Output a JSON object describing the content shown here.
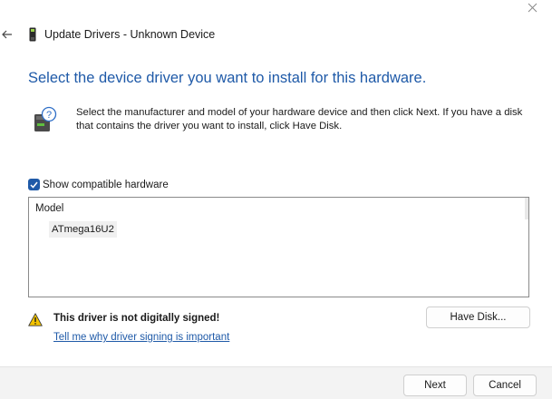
{
  "window": {
    "title": "Update Drivers - Unknown Device",
    "close_icon": "close-icon",
    "back_icon": "arrow-left-icon",
    "device_icon": "usb-device-icon"
  },
  "main": {
    "heading": "Select the device driver you want to install for this hardware.",
    "info_icon": "hardware-help-icon",
    "description": "Select the manufacturer and model of your hardware device and then click Next. If you have a disk that contains the driver you want to install, click Have Disk.",
    "show_compatible": {
      "label": "Show compatible hardware",
      "checked": true
    },
    "model_list": {
      "header": "Model",
      "items": [
        "ATmega16U2"
      ],
      "selected_index": 0
    },
    "warning": {
      "icon": "warning-icon",
      "text": "This driver is not digitally signed!",
      "link": "Tell me why driver signing is important"
    },
    "have_disk_label": "Have Disk..."
  },
  "footer": {
    "next_label": "Next",
    "cancel_label": "Cancel"
  },
  "colors": {
    "accent": "#1f5aa8",
    "warning": "#f2c200",
    "footer_bg": "#f3f3f3"
  }
}
